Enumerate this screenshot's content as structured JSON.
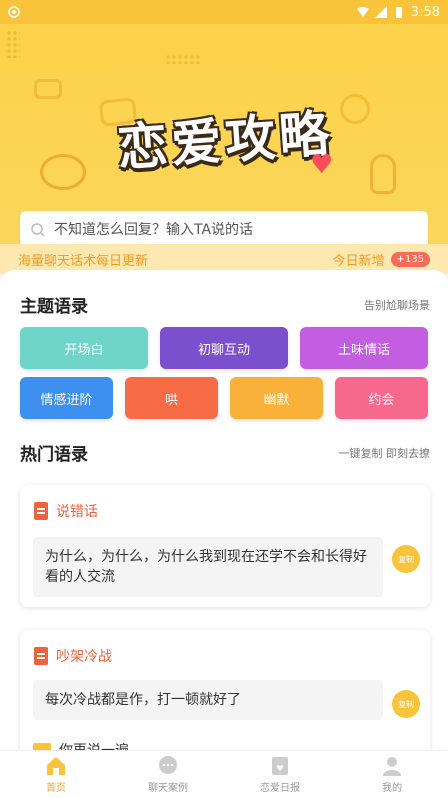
{
  "status_bar": {
    "time": "3:58"
  },
  "hero": {
    "title": "恋爱攻略"
  },
  "search": {
    "placeholder": "不知道怎么回复？输入TA说的话"
  },
  "ticker": {
    "left": "海量聊天话术每日更新",
    "right": "今日新增",
    "badge": "+135"
  },
  "topics_section": {
    "title": "主题语录",
    "subtitle": "告别尬聊场景",
    "items": [
      {
        "label": "开场白",
        "color": "#6fd4c9"
      },
      {
        "label": "初聊互动",
        "color": "#7b4fce"
      },
      {
        "label": "土味情话",
        "color": "#c35ee0"
      },
      {
        "label": "情感进阶",
        "color": "#3d8ff0"
      },
      {
        "label": "哄",
        "color": "#f76b45"
      },
      {
        "label": "幽默",
        "color": "#f9b13a"
      },
      {
        "label": "约会",
        "color": "#f6688c"
      }
    ]
  },
  "hot_section": {
    "title": "热门语录",
    "subtitle": "一键复制 即刻去撩",
    "cards": [
      {
        "category": "说错话",
        "text": "为什么，为什么，为什么我到现在还学不会和长得好看的人交流",
        "copy_label": "复制"
      },
      {
        "category": "吵架冷战",
        "text": "每次冷战都是作，打一顿就好了",
        "copy_label": "复制"
      }
    ],
    "peek_label": "你再说一遍"
  },
  "tabbar": {
    "items": [
      {
        "label": "首页",
        "icon": "home-icon",
        "active": true
      },
      {
        "label": "聊天案例",
        "icon": "chat-icon",
        "active": false
      },
      {
        "label": "恋爱日报",
        "icon": "daily-icon",
        "active": false
      },
      {
        "label": "我的",
        "icon": "profile-icon",
        "active": false
      }
    ]
  },
  "colors": {
    "accent": "#f9c43a",
    "orange": "#f0623b"
  }
}
